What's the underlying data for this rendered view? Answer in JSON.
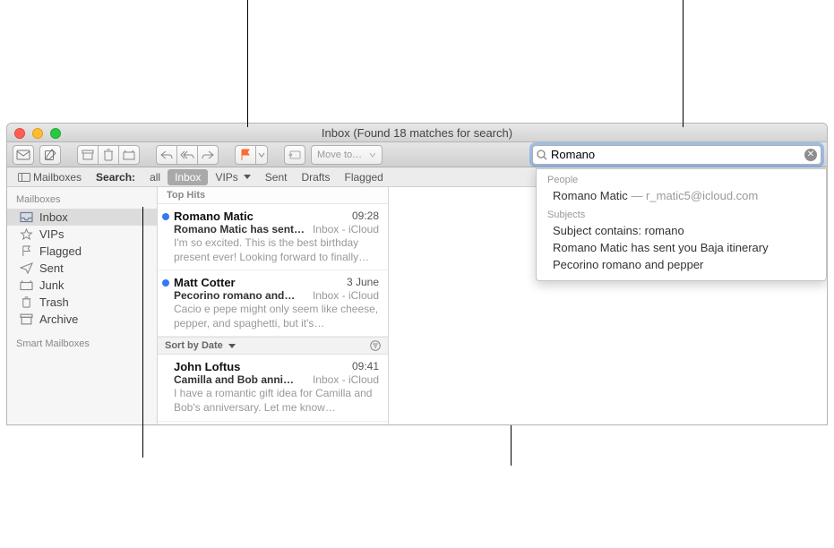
{
  "window": {
    "title": "Inbox (Found 18 matches for search)"
  },
  "search": {
    "value": "Romano"
  },
  "favbar": {
    "mailboxes_label": "Mailboxes",
    "search_label": "Search:",
    "tabs": {
      "all": "all",
      "inbox": "Inbox",
      "vips": "VIPs",
      "sent": "Sent",
      "drafts": "Drafts",
      "flagged": "Flagged"
    }
  },
  "sidebar": {
    "header1": "Mailboxes",
    "header2": "Smart Mailboxes",
    "items": {
      "inbox": "Inbox",
      "vips": "VIPs",
      "flagged": "Flagged",
      "sent": "Sent",
      "junk": "Junk",
      "trash": "Trash",
      "archive": "Archive"
    }
  },
  "msglist": {
    "tophits": "Top Hits",
    "sort_label": "Sort by Date",
    "msgs": [
      {
        "from": "Romano Matic",
        "date": "09:28",
        "subject": "Romano Matic has sent…",
        "location": "Inbox - iCloud",
        "preview": "I'm so excited. This is the best birthday present ever! Looking forward to finally…",
        "unread": true
      },
      {
        "from": "Matt Cotter",
        "date": "3 June",
        "subject": "Pecorino romano and…",
        "location": "Inbox - iCloud",
        "preview": "Cacio e pepe might only seem like cheese, pepper, and spaghetti, but it's…",
        "unread": true
      },
      {
        "from": "John Loftus",
        "date": "09:41",
        "subject": "Camilla and Bob anni…",
        "location": "Inbox - iCloud",
        "preview": "I have a romantic gift idea for Camilla and Bob's anniversary. Let me know…",
        "unread": false
      }
    ]
  },
  "suggestions": {
    "people_header": "People",
    "people": [
      {
        "name": "Romano Matic",
        "email": "— r_matic5@icloud.com"
      }
    ],
    "subjects_header": "Subjects",
    "subjects": [
      "Subject contains: romano",
      "Romano Matic has sent you Baja itinerary",
      "Pecorino romano and pepper"
    ]
  },
  "toolbar": {
    "moveto_label": "Move to…"
  }
}
